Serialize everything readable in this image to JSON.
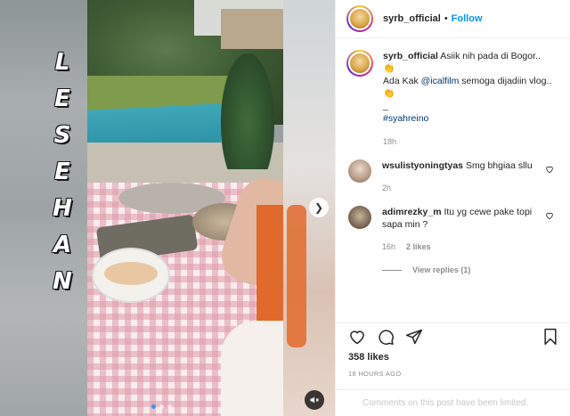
{
  "media": {
    "overlay_letters": [
      "L",
      "E",
      "S",
      "E",
      "H",
      "A",
      "N"
    ],
    "carousel": {
      "total": 3,
      "active_index": 0
    }
  },
  "post": {
    "username": "syrb_official",
    "separator": "•",
    "follow_label": "Follow",
    "caption": {
      "line1": "Asiik nih pada di Bogor..",
      "line2_pre": "Ada Kak ",
      "mention": "@icalfilm",
      "line2_post": " semoga dijadiin vlog..",
      "dash": "_",
      "hashtag": "#syahreino",
      "time": "18h"
    },
    "comments": [
      {
        "username": "wsulistyoningtyas",
        "text": "Smg bhgiaa sllu",
        "time": "2h",
        "likes": ""
      },
      {
        "username": "adimrezky_m",
        "text": "Itu yg cewe pake topi sapa min ?",
        "time": "16h",
        "likes": "2 likes",
        "view_replies": "View replies (1)"
      }
    ],
    "likes": "358 likes",
    "posted_ago": "18 HOURS AGO",
    "comments_limited": "Comments on this post have been limited."
  },
  "colors": {
    "follow": "#0095f6",
    "link": "#00376b",
    "muted": "#8e8e8e",
    "accent_dot": "#3897f0"
  },
  "icons": [
    "chevron-right-icon",
    "speaker-muted-icon",
    "heart-icon",
    "comment-icon",
    "share-icon",
    "bookmark-icon",
    "clap-emoji-icon"
  ]
}
